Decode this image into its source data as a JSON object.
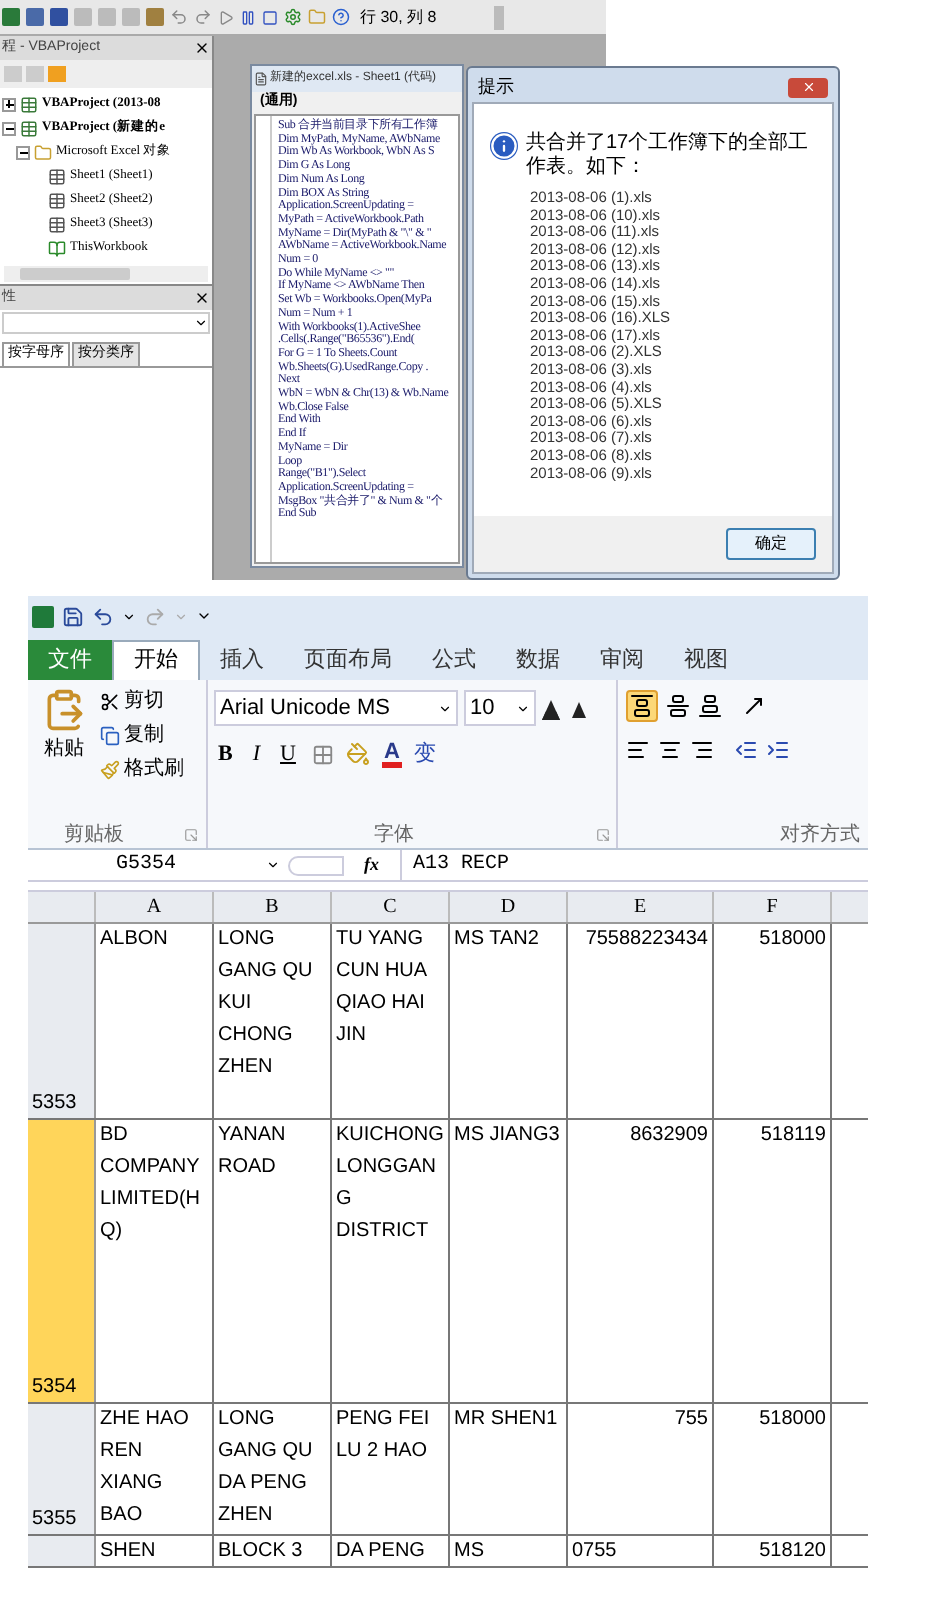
{
  "vbe": {
    "toolbar": {
      "position": "行 30, 列 8"
    },
    "project_panel": {
      "title": "程 - VBAProject",
      "tree": [
        {
          "label": "VBAProject (2013-08",
          "kind": "project",
          "expanded": false
        },
        {
          "label": "VBAProject (新建的e",
          "kind": "project",
          "expanded": true,
          "children": [
            {
              "label": "Microsoft Excel 对象",
              "kind": "folder",
              "expanded": true,
              "children": [
                {
                  "label": "Sheet1 (Sheet1)",
                  "kind": "sheet"
                },
                {
                  "label": "Sheet2 (Sheet2)",
                  "kind": "sheet"
                },
                {
                  "label": "Sheet3 (Sheet3)",
                  "kind": "sheet"
                },
                {
                  "label": "ThisWorkbook",
                  "kind": "workbook"
                }
              ]
            }
          ]
        }
      ]
    },
    "properties_panel": {
      "title": "性",
      "tabs": [
        {
          "label": "按字母序",
          "selected": true
        },
        {
          "label": "按分类序",
          "selected": false
        }
      ]
    },
    "code_window": {
      "title": "新建的excel.xls - Sheet1 (代码)",
      "object": "(通用)",
      "lines": [
        "Sub 合并当前目录下所有工作簿",
        "Dim MyPath, MyName, AWbName",
        "Dim Wb As Workbook, WbN As S",
        "Dim G As Long",
        "Dim Num As Long",
        "Dim BOX As String",
        "Application.ScreenUpdating =",
        "MyPath = ActiveWorkbook.Path",
        "MyName = Dir(MyPath & \"\\\" & \"",
        "AWbName = ActiveWorkbook.Name",
        "Num = 0",
        "Do While MyName <> \"\"",
        "If MyName <> AWbName Then",
        "Set Wb = Workbooks.Open(MyPa",
        "Num = Num + 1",
        "With Workbooks(1).ActiveShee",
        ".Cells(.Range(\"B65536\").End(",
        "For G = 1 To Sheets.Count",
        "Wb.Sheets(G).UsedRange.Copy .",
        "Next",
        "WbN = WbN & Chr(13) & Wb.Name",
        "Wb.Close False",
        "End With",
        "End If",
        "MyName = Dir",
        "Loop",
        "Range(\"B1\").Select",
        "Application.ScreenUpdating =",
        "MsgBox \"共合并了\" & Num & \"个",
        "End Sub"
      ]
    }
  },
  "dialog": {
    "title": "提示",
    "message": "共合并了17个工作簿下的全部工作表。如下：",
    "files": [
      "2013-08-06 (1).xls",
      "2013-08-06 (10).xls",
      "2013-08-06 (11).xls",
      "2013-08-06 (12).xls",
      "2013-08-06 (13).xls",
      "2013-08-06 (14).xls",
      "2013-08-06 (15).xls",
      "2013-08-06 (16).XLS",
      "2013-08-06 (17).xls",
      "2013-08-06 (2).XLS",
      "2013-08-06 (3).xls",
      "2013-08-06 (4).xls",
      "2013-08-06 (5).XLS",
      "2013-08-06 (6).xls",
      "2013-08-06 (7).xls",
      "2013-08-06 (8).xls",
      "2013-08-06 (9).xls"
    ],
    "ok": "确定"
  },
  "excel": {
    "tabs": [
      {
        "label": "文件",
        "kind": "file",
        "selected": false
      },
      {
        "label": "开始",
        "kind": "tab",
        "selected": true
      },
      {
        "label": "插入",
        "kind": "tab",
        "selected": false
      },
      {
        "label": "页面布局",
        "kind": "tab",
        "selected": false
      },
      {
        "label": "公式",
        "kind": "tab",
        "selected": false
      },
      {
        "label": "数据",
        "kind": "tab",
        "selected": false
      },
      {
        "label": "审阅",
        "kind": "tab",
        "selected": false
      },
      {
        "label": "视图",
        "kind": "tab",
        "selected": false
      }
    ],
    "clipboard": {
      "paste": "粘贴",
      "cut": "剪切",
      "copy": "复制",
      "format_painter": "格式刷",
      "group": "剪贴板"
    },
    "font": {
      "name": "Arial Unicode MS",
      "size": "10",
      "bold": "B",
      "italic": "I",
      "underline": "U",
      "font_color": "A",
      "phonetic": "变",
      "group": "字体"
    },
    "alignment": {
      "group": "对齐方式"
    },
    "name_box": "G5354",
    "function_label": "fx",
    "formula": "A13 RECP",
    "columns": [
      "A",
      "B",
      "C",
      "D",
      "E",
      "F"
    ],
    "rows": [
      {
        "number": "5353",
        "selected": false,
        "cells": [
          "ALBON",
          "LONG GANG QU KUI CHONG ZHEN",
          "TU YANG CUN HUA QIAO HAI JIN",
          "MS TAN2",
          {
            "text": "75588223434",
            "kind": "number"
          },
          {
            "text": "518000",
            "kind": "number"
          }
        ]
      },
      {
        "number": "5354",
        "selected": true,
        "cells": [
          "BD COMPANY LIMITED(HQ)",
          "YANAN ROAD",
          "KUICHONG LONGGANG DISTRICT",
          "MS JIANG3",
          {
            "text": "8632909",
            "kind": "number"
          },
          {
            "text": "518119",
            "kind": "number"
          }
        ]
      },
      {
        "number": "5355",
        "selected": false,
        "cells": [
          "ZHE HAO REN XIANG BAO",
          "LONG GANG QU DA PENG ZHEN",
          "PENG FEI LU 2 HAO",
          "MR SHEN1",
          {
            "text": "755",
            "kind": "number"
          },
          {
            "text": "518000",
            "kind": "number"
          }
        ]
      },
      {
        "number": "",
        "selected": false,
        "cells": [
          "SHEN",
          "BLOCK 3",
          "DA PENG",
          "MS",
          "0755",
          {
            "text": "518120",
            "kind": "number"
          }
        ]
      }
    ]
  }
}
